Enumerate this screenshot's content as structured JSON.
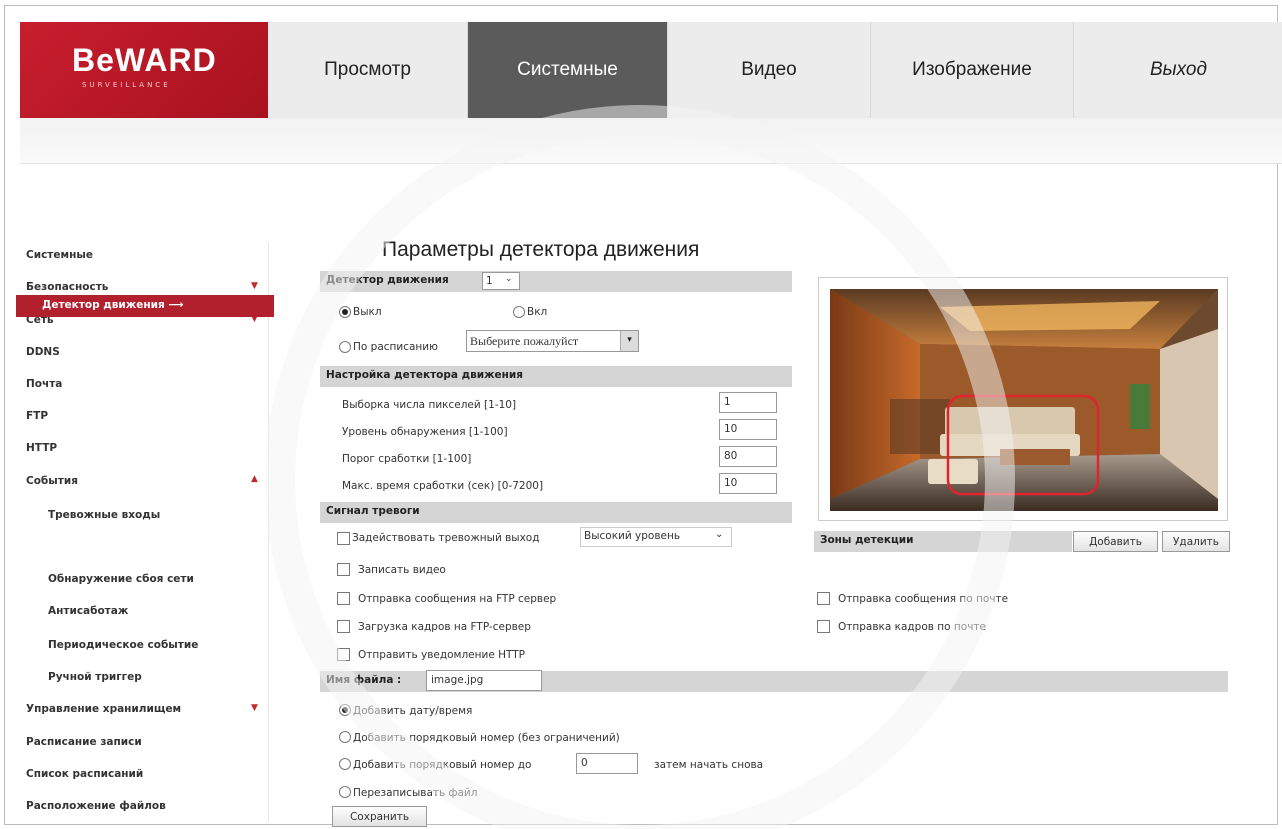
{
  "logo": {
    "text": "BeWARD",
    "sub": "SURVEILLANCE"
  },
  "nav": {
    "view": "Просмотр",
    "system": "Системные",
    "video": "Видео",
    "image": "Изображение",
    "exit": "Выход"
  },
  "sidebar": {
    "items": [
      "Системные",
      "Безопасность",
      "Сеть",
      "DDNS",
      "Почта",
      "FTP",
      "HTTP",
      "События"
    ],
    "events": [
      "Тревожные входы",
      "Детектор движения",
      "Обнаружение сбоя сети",
      "Антисаботаж",
      "Периодическое событие",
      "Ручной триггер"
    ],
    "bottom": [
      "Управление хранилищем",
      "Расписание записи",
      "Список расписаний",
      "Расположение файлов"
    ]
  },
  "main": {
    "title": "Параметры детектора движения",
    "detector_label": "Детектор движения",
    "detector_value": "1",
    "off": "Выкл",
    "on": "Вкл",
    "schedule": "По расписанию",
    "schedule_placeholder": "Выберите пожалуйст",
    "settings_header": "Настройка детектора движения",
    "pixels_label": "Выборка числа пикселей [1-10]",
    "pixels_value": "1",
    "level_label": "Уровень обнаружения [1-100]",
    "level_value": "10",
    "threshold_label": "Порог сработки [1-100]",
    "threshold_value": "80",
    "maxtime_label": "Макс. время сработки (сек) [0-7200]",
    "maxtime_value": "10",
    "alarm_header": "Сигнал тревоги",
    "alarm_out_label": "Задействовать тревожный выход",
    "alarm_out_level": "Высокий уровень",
    "record_video": "Записать видео",
    "ftp_message": "Отправка сообщения на FTP сервер",
    "ftp_frames": "Загрузка кадров на FTP-сервер",
    "http_notify": "Отправить уведомление HTTP",
    "mail_message": "Отправка сообщения по почте",
    "mail_frames": "Отправка кадров по почте",
    "zones_label": "Зоны детекции",
    "add_button": "Добавить",
    "delete_button": "Удалить",
    "filename_label": "Имя файла :",
    "filename_value": "image.jpg",
    "opt_datetime": "Добавить дату/время",
    "opt_seq_unlimited": "Добавить порядковый номер (без ограничений)",
    "opt_seq_to": "Добавить порядковый номер до",
    "opt_seq_to_value": "0",
    "opt_seq_restart": "затем начать снова",
    "opt_overwrite": "Перезаписывать файл",
    "save_button": "Сохранить"
  },
  "colors": {
    "brand": "#b3202d",
    "active_tab": "#5b5b5b",
    "bar": "#d5d5d5"
  }
}
